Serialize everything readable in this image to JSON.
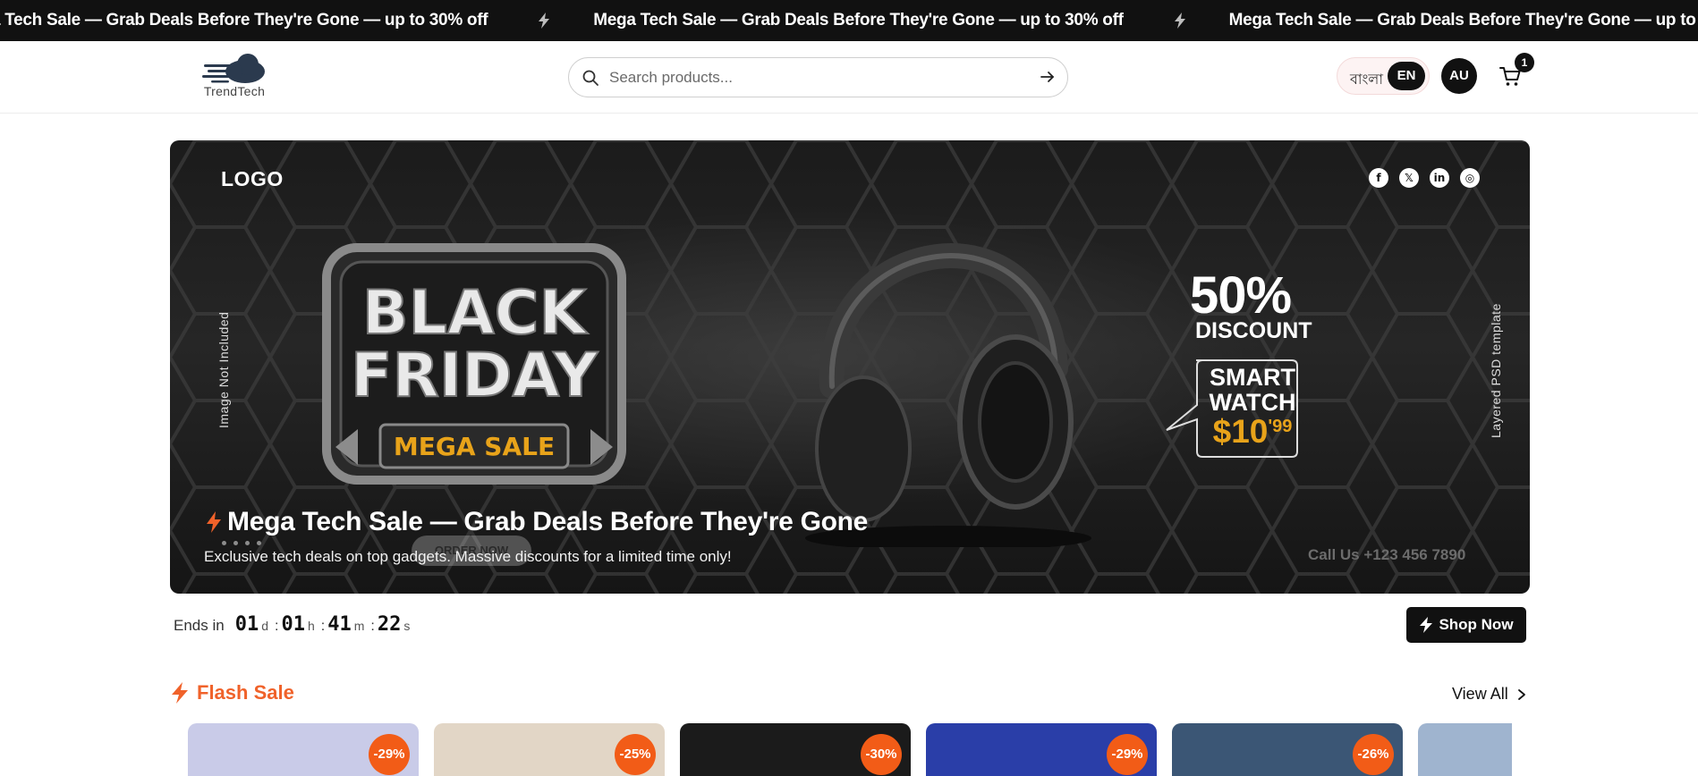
{
  "ticker": {
    "message": "Mega Tech Sale — Grab Deals Before They're Gone — up to 30% off",
    "partial_start": "a Tech Sale — Grab Deals Before They're Gone — up to 30% off",
    "partial_end": "Mega"
  },
  "header": {
    "logo_text": "TrendTech",
    "search_placeholder": "Search products...",
    "lang_bn": "বাংলা",
    "lang_en": "EN",
    "avatar_initials": "AU",
    "cart_count": "1"
  },
  "banner": {
    "logo": "LOGO",
    "vertical_left": "Image Not Included",
    "vertical_right": "Layered PSD template",
    "bf_line1": "BLACK",
    "bf_line2": "FRIDAY",
    "mega_sale": "MEGA SALE",
    "discount_pct": "50%",
    "discount_word": "DISCOUNT",
    "bubble_line1": "SMART",
    "bubble_line2": "WATCH",
    "bubble_price": "$10",
    "bubble_cents": "'99",
    "order_now": "ORDER NOW",
    "call_us": "Call Us +123 456 7890",
    "title": "Mega Tech Sale — Grab Deals Before They're Gone",
    "subtitle": "Exclusive tech deals on top gadgets. Massive discounts for a limited time only!",
    "socials": [
      "f",
      "𝕏",
      "in",
      "◎"
    ]
  },
  "countdown": {
    "label": "Ends in",
    "days": "01",
    "days_unit": "d",
    "hours": "01",
    "hours_unit": "h",
    "minutes": "41",
    "minutes_unit": "m",
    "seconds": "22",
    "seconds_unit": "s"
  },
  "shop_now": "Shop Now",
  "flash_sale": {
    "title": "Flash Sale",
    "view_all": "View All",
    "cards": [
      {
        "discount": "-29%",
        "bg": "#c9cbe8"
      },
      {
        "discount": "-25%",
        "bg": "#e2d6c6"
      },
      {
        "discount": "-30%",
        "bg": "#1b1b1b"
      },
      {
        "discount": "-29%",
        "bg": "#2a3ea8"
      },
      {
        "discount": "-26%",
        "bg": "#3b5675"
      },
      {
        "discount": "",
        "bg": "#9fb4cf"
      }
    ]
  },
  "colors": {
    "accent_orange": "#f0622a",
    "badge_orange": "#f25c17",
    "dark": "#111111",
    "price_gold": "#e8a31a"
  }
}
